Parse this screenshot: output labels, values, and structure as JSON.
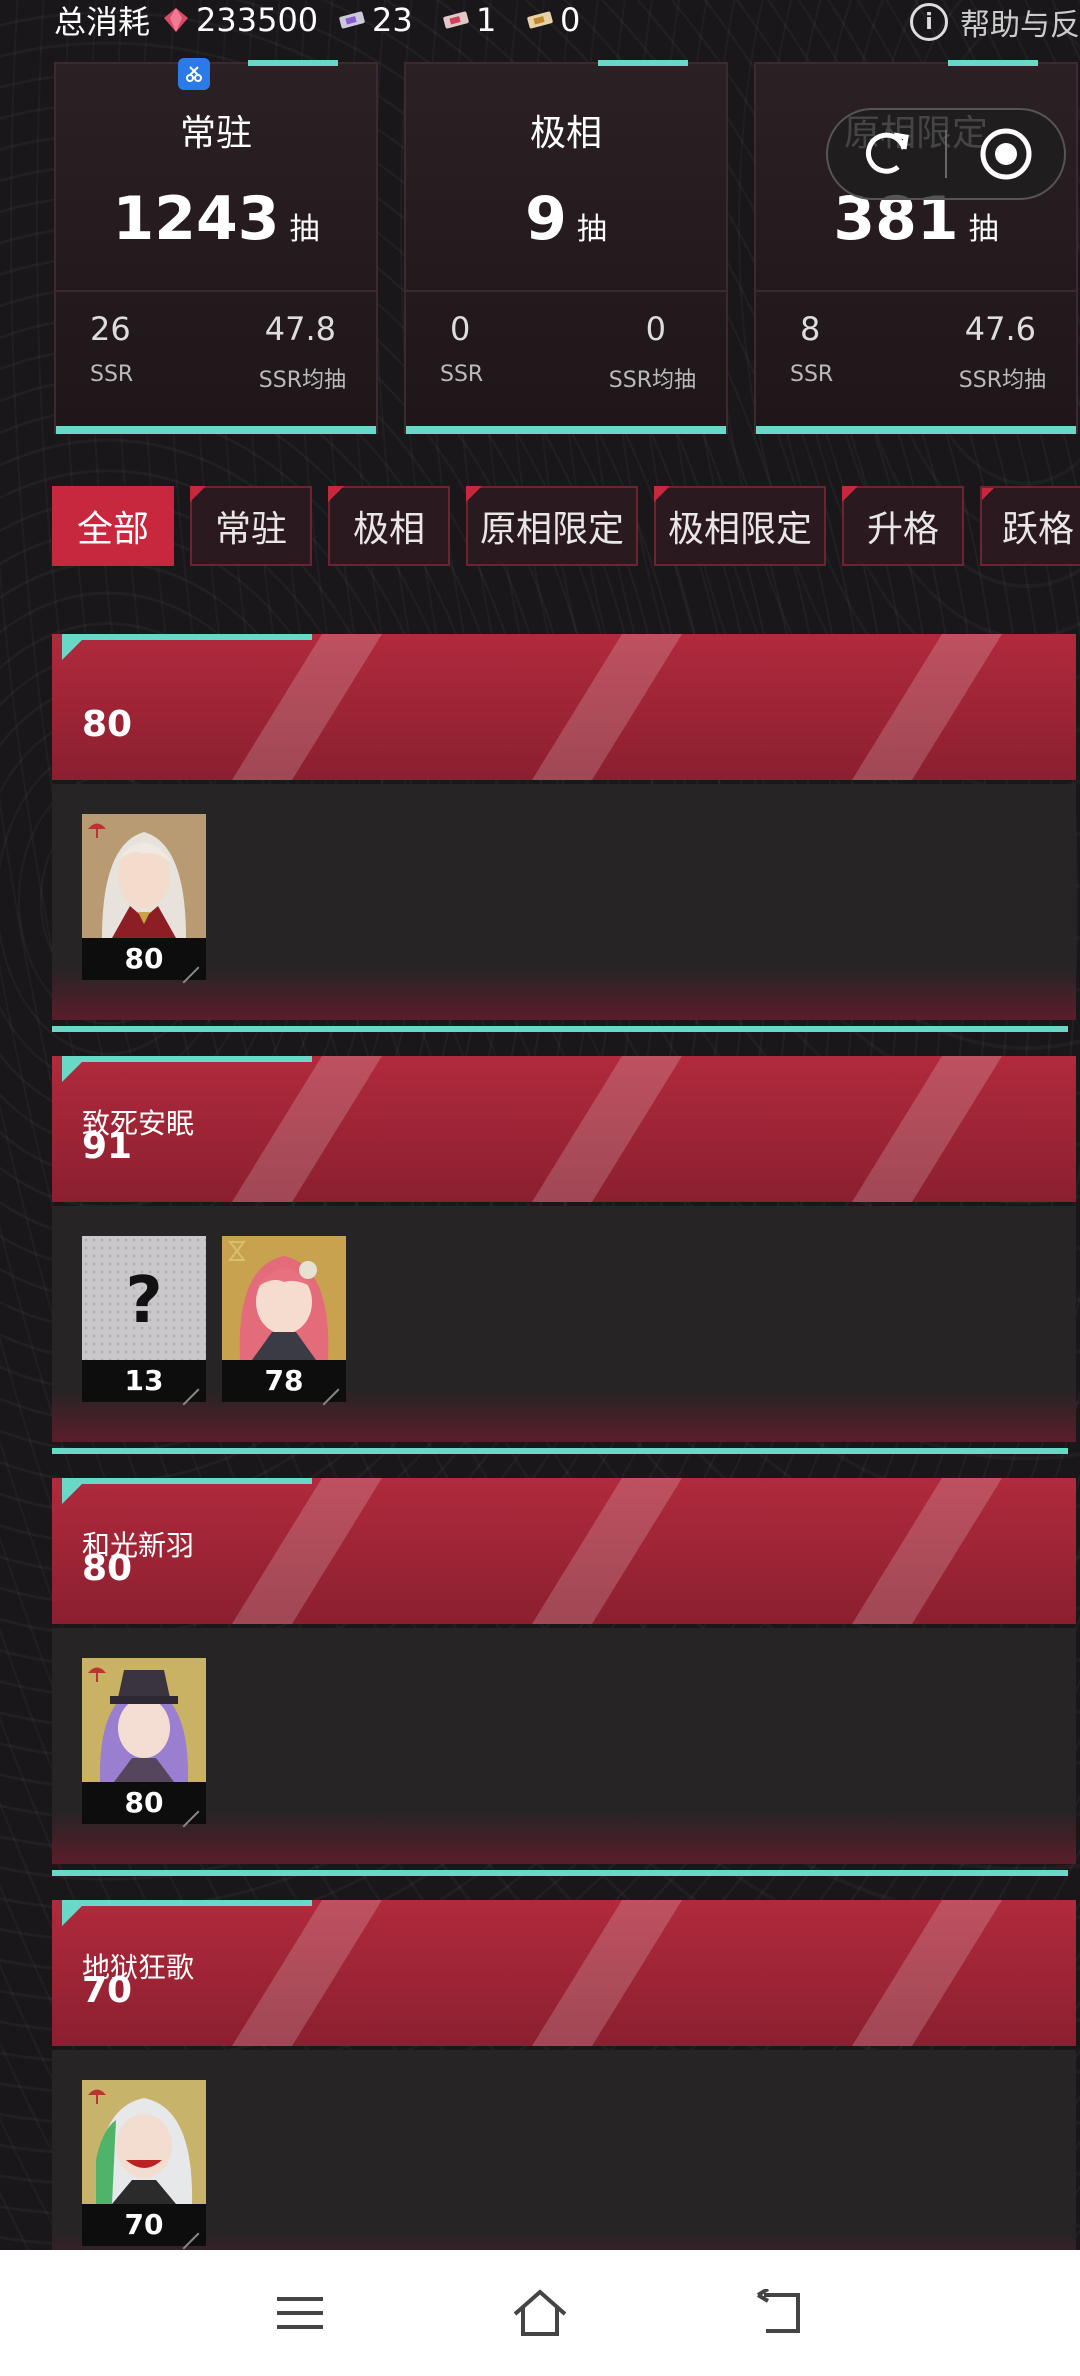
{
  "topbar": {
    "label": "总消耗",
    "gems": "233500",
    "ticket_a": "23",
    "ticket_b": "1",
    "ticket_c": "0",
    "help": "帮助与反"
  },
  "cards": [
    {
      "title": "常驻",
      "pulls": "1243",
      "unit": "抽",
      "ssr": "26",
      "ssr_label": "SSR",
      "avg": "47.8",
      "avg_label": "SSR均抽"
    },
    {
      "title": "极相",
      "pulls": "9",
      "unit": "抽",
      "ssr": "0",
      "ssr_label": "SSR",
      "avg": "0",
      "avg_label": "SSR均抽"
    },
    {
      "title": "原相限定",
      "pulls": "381",
      "unit": "抽",
      "ssr": "8",
      "ssr_label": "SSR",
      "avg": "47.6",
      "avg_label": "SSR均抽"
    }
  ],
  "tabs": [
    "全部",
    "常驻",
    "极相",
    "原相限定",
    "极相限定",
    "升格",
    "跃格"
  ],
  "sections": [
    {
      "name": "",
      "total": "80",
      "chars": [
        {
          "pulls": "80",
          "portrait": "white-hair-man"
        }
      ]
    },
    {
      "name": "致死安眠",
      "total": "91",
      "chars": [
        {
          "pulls": "13",
          "portrait": "unknown"
        },
        {
          "pulls": "78",
          "portrait": "pink-hair-girl"
        }
      ]
    },
    {
      "name": "和光新羽",
      "total": "80",
      "chars": [
        {
          "pulls": "80",
          "portrait": "purple-hair-girl"
        }
      ]
    },
    {
      "name": "地狱狂歌",
      "total": "70",
      "chars": [
        {
          "pulls": "70",
          "portrait": "silver-hair-girl"
        }
      ]
    }
  ],
  "colors": {
    "accent": "#6ad8c6",
    "primary_red": "#c8283e",
    "dark_bg": "#19171a"
  }
}
